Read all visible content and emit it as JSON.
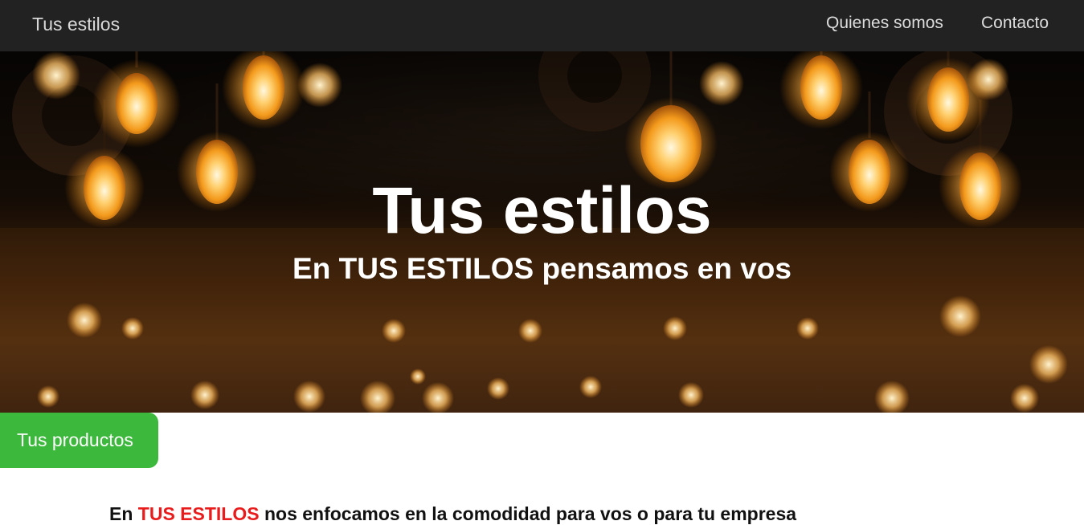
{
  "navbar": {
    "brand": "Tus estilos",
    "links": [
      "Quienes somos",
      "Contacto"
    ]
  },
  "hero": {
    "title": "Tus estilos",
    "subtitle": "En TUS ESTILOS pensamos en vos",
    "background": "edison bulb lights photo"
  },
  "products_button": {
    "label": "Tus productos",
    "color": "#3cb83c"
  },
  "intro": {
    "prefix": "En",
    "highlight": "TUS ESTILOS",
    "suffix": "nos enfocamos en la comodidad para vos o para tu empresa",
    "highlight_color": "#e81c1c"
  }
}
